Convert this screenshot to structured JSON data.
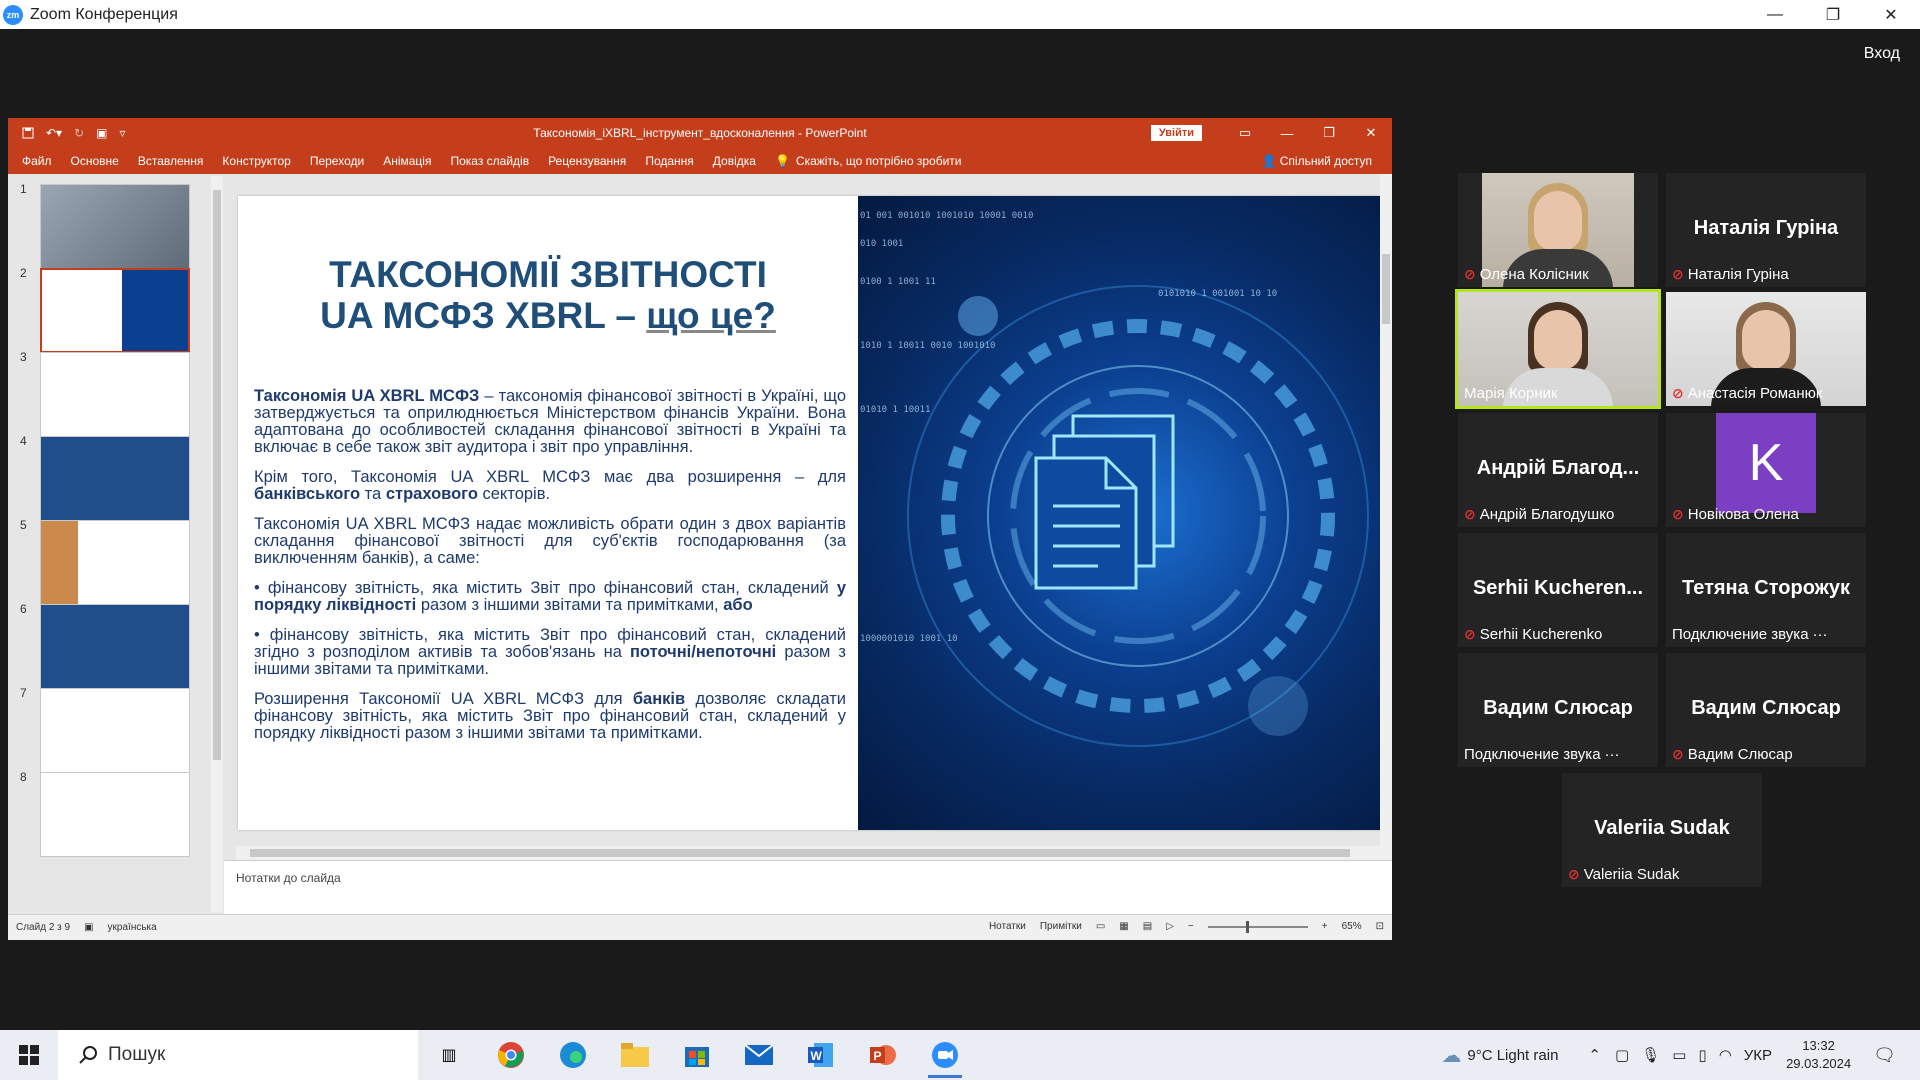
{
  "window": {
    "title": "Zoom Конференция",
    "min": "—",
    "restore": "❐",
    "close": "✕"
  },
  "zoom": {
    "signin": "Вход"
  },
  "ppt": {
    "doc_title": "Таксономія_iXBRL_інструмент_вдосконалення - PowerPoint",
    "signin": "Увійти",
    "tabs": [
      "Файл",
      "Основне",
      "Вставлення",
      "Конструктор",
      "Переходи",
      "Анімація",
      "Показ слайдів",
      "Рецензування",
      "Подання",
      "Довідка"
    ],
    "tell_me": "Скажіть, що потрібно зробити",
    "share": "Спільний доступ",
    "thumbs": [
      "1",
      "2",
      "3",
      "4",
      "5",
      "6",
      "7",
      "8"
    ],
    "notes_placeholder": "Нотатки до слайда",
    "status": {
      "slide": "Слайд 2 з 9",
      "lang": "українська",
      "notes": "Нотатки",
      "comments": "Примітки",
      "zoom": "65%"
    }
  },
  "slide": {
    "title_line1": "ТАКСОНОМІЇ ЗВІТНОСТІ",
    "title_line2_a": "UA МСФЗ XBRL – ",
    "title_line2_b": "що це?",
    "p1_bold": "Таксономія UA XBRL МСФЗ",
    "p1_rest": " – таксономія фінансової звітності в Україні, що затверджується та оприлюднюється Міністерством фінансів України. Вона адаптована до особливостей складання фінансової звітності в Україні та включає в себе також звіт аудитора і звіт про управління.",
    "p2_a": "Крім того, Таксономія UA XBRL МСФЗ має два розширення – для ",
    "p2_b1": "банківського",
    "p2_c": " та ",
    "p2_b2": "страхового",
    "p2_d": " секторів.",
    "p3": "Таксономія UA XBRL МСФЗ надає можливість обрати один з двох варіантів складання фінансової звітності для суб'єктів господарювання (за виключенням банків), а саме:",
    "b1_a": "• фінансову звітність, яка містить Звіт про фінансовий стан, складений ",
    "b1_b": "у порядку ліквідності",
    "b1_c": " разом з іншими звітами та примітками, ",
    "b1_d": "або",
    "b2_a": "• фінансову звітність, яка містить Звіт про фінансовий стан, складений згідно з розподілом активів та зобов'язань на ",
    "b2_b": "поточні/непоточні",
    "b2_c": " разом з іншими звітами та примітками.",
    "p4_a": "Розширення Таксономії UA XBRL МСФЗ для ",
    "p4_b": "банків",
    "p4_c": " дозволяє складати фінансову звітність, яка містить Звіт про фінансовий стан, складений у порядку ліквідності разом з іншими звітами та примітками.",
    "binary": [
      "01 001 001010 1001010 10001 0010",
      "010 1001",
      "0101010 1 001001 10 10",
      "0100 1 1001 11",
      "1010 1 10011 0010 1001010",
      "01010 1 10011",
      "1000001010 1001 10"
    ]
  },
  "participants": [
    {
      "name": "Олена Колісник",
      "big": "",
      "status": ""
    },
    {
      "name": "Наталія Гуріна",
      "big": "Наталія Гуріна",
      "status": ""
    },
    {
      "name": "Марія Корник",
      "big": "",
      "status": ""
    },
    {
      "name": "Анастасія Романюк",
      "big": "",
      "status": ""
    },
    {
      "name": "Андрій Благодушко",
      "big": "Андрій Благод...",
      "status": ""
    },
    {
      "name": "Новікова Олена",
      "big": "",
      "status": "",
      "avatar": "K"
    },
    {
      "name": "Serhii Kucherenko",
      "big": "Serhii  Kucheren...",
      "status": ""
    },
    {
      "name": "",
      "big": "Тетяна Сторожук",
      "status": "Подключение звука"
    },
    {
      "name": "",
      "big": "Вадим Слюсар",
      "status": "Подключение звука"
    },
    {
      "name": "Вадим Слюсар",
      "big": "Вадим Слюсар",
      "status": ""
    },
    {
      "name": "Valeriia Sudak",
      "big": "Valeriia Sudak",
      "status": ""
    }
  ],
  "taskbar": {
    "search": "Пошук",
    "weather": "9°C  Light rain",
    "lang": "УКР",
    "time": "13:32",
    "date": "29.03.2024"
  }
}
